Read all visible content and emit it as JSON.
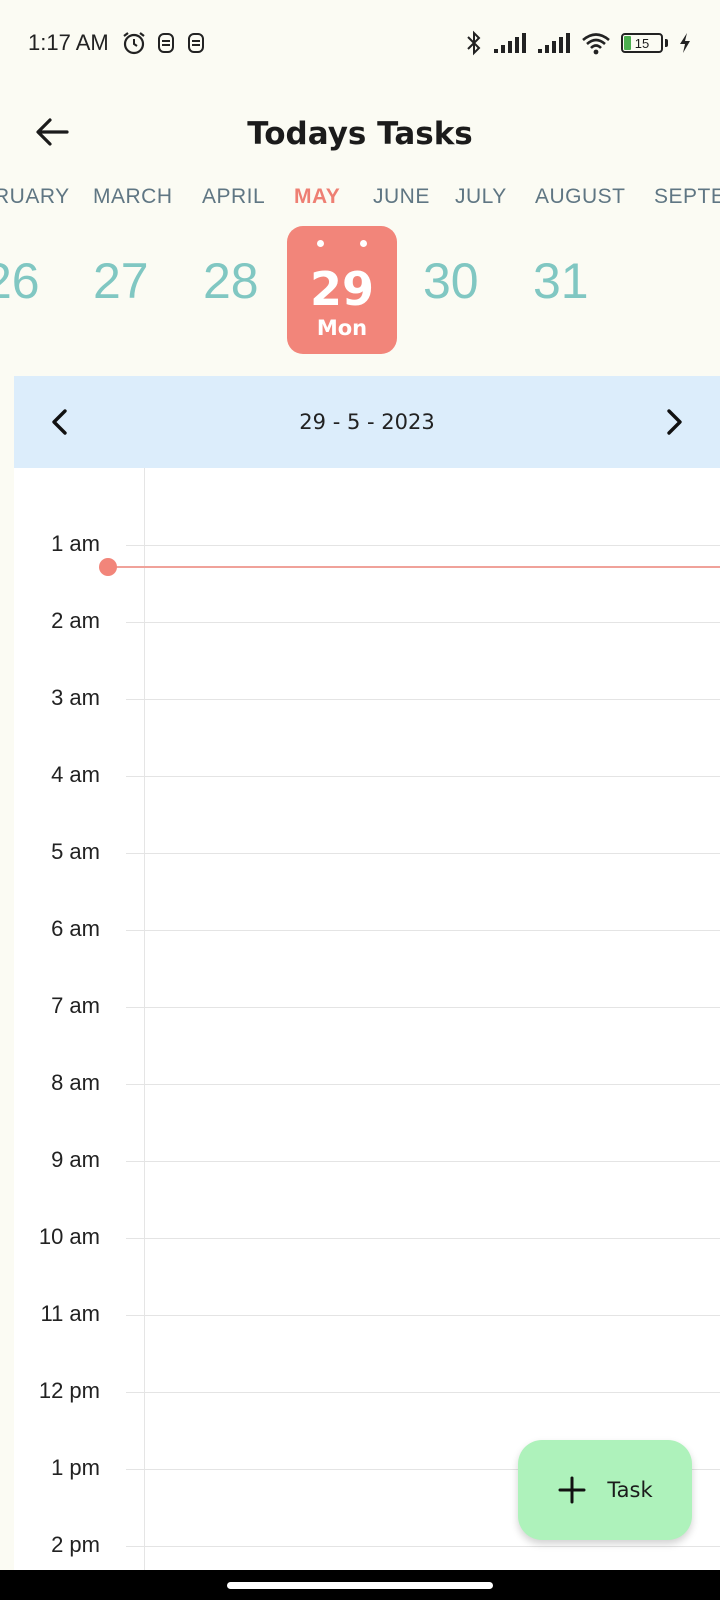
{
  "status_bar": {
    "time": "1:17 AM",
    "battery_level": "15",
    "icons": [
      "alarm-icon",
      "notification-icon",
      "notification-icon",
      "bluetooth-icon",
      "signal-icon",
      "signal-icon",
      "wifi-icon",
      "battery-icon",
      "charging-icon"
    ]
  },
  "header": {
    "title": "Todays Tasks",
    "back_icon": "arrow-left-icon"
  },
  "months": {
    "items": [
      "RUARY",
      "MARCH",
      "APRIL",
      "MAY",
      "JUNE",
      "JULY",
      "AUGUST",
      "SEPTE"
    ],
    "selected": "MAY"
  },
  "days": {
    "items": [
      "26",
      "27",
      "28",
      "30",
      "31"
    ],
    "selected": {
      "day": "29",
      "weekday": "Mon"
    }
  },
  "date_nav": {
    "date": "29 - 5 - 2023",
    "prev_icon": "chevron-left-icon",
    "next_icon": "chevron-right-icon"
  },
  "schedule": {
    "hours": [
      "1 am",
      "2 am",
      "3 am",
      "4 am",
      "5 am",
      "6 am",
      "7 am",
      "8 am",
      "9 am",
      "10 am",
      "11 am",
      "12 pm",
      "1 pm",
      "2 pm"
    ],
    "current_time": "1:17 AM"
  },
  "fab": {
    "label": "Task",
    "icon": "plus-icon"
  },
  "colors": {
    "accent": "#f2857a",
    "day_text": "#80c7c2",
    "month_text": "#5f7683",
    "nav_background": "#dcedfb",
    "fab_background": "#aef2bb",
    "app_background": "#fbfbf3"
  }
}
